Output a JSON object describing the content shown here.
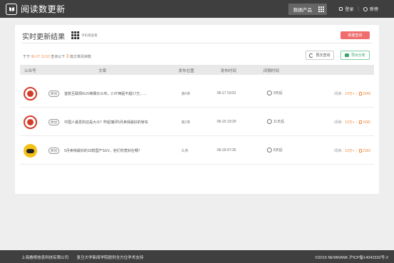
{
  "header": {
    "app_title": "阅读数更新",
    "data_products_label": "数据产品",
    "login_label": "登录",
    "register_label": "新榜"
  },
  "main": {
    "title": "实时更新结果",
    "qr_label": "手机端查看",
    "new_query_label": "新建查询",
    "status": {
      "prefix": "于于",
      "timestamp": "06-27 11:52",
      "middle": "查询以下",
      "count": "3",
      "suffix": "篇文章阅读数"
    },
    "requery_label": "再次查询",
    "export_label": "导出分析",
    "columns": [
      "公众号",
      "文章",
      "发布位置",
      "发布时间",
      "间隔时间"
    ],
    "rows": [
      {
        "tag": "原创",
        "title": "首款互联网SUV荣膺价公布，2.0T两驱不超17万，...",
        "position": "第6条",
        "publish_time": "06-17 19:01",
        "interval": "9天后",
        "read_label": "阅读：",
        "reads": "10万+",
        "likes": "2049"
      },
      {
        "tag": "原创",
        "title": "中国人最爱的还是大众？昨起捕评5月卖得最好的轿车",
        "position": "第2条",
        "publish_time": "06-15 19:29",
        "interval": "11天后",
        "read_label": "阅读：",
        "reads": "10万+",
        "likes": "1695"
      },
      {
        "tag": "原创",
        "title": "5月卖得最好的10款国产SUV，他们究竟好在哪？",
        "position": "头条",
        "publish_time": "06-18 07:26",
        "interval": "8天后",
        "read_label": "阅读：",
        "reads": "10万+",
        "likes": "2183"
      }
    ]
  },
  "footer": {
    "company": "上海看榜信息科技有限公司",
    "support": "复旦大学新闻学院提供全方位学术支持",
    "copyright": "©2016 NEWRANK 沪ICP备14042332号-2"
  },
  "colors": {
    "topbar": "#3f3f3f",
    "accent_orange": "#f08a3c",
    "new_button": "#ef6d6d",
    "export_green": "#3aa567"
  }
}
